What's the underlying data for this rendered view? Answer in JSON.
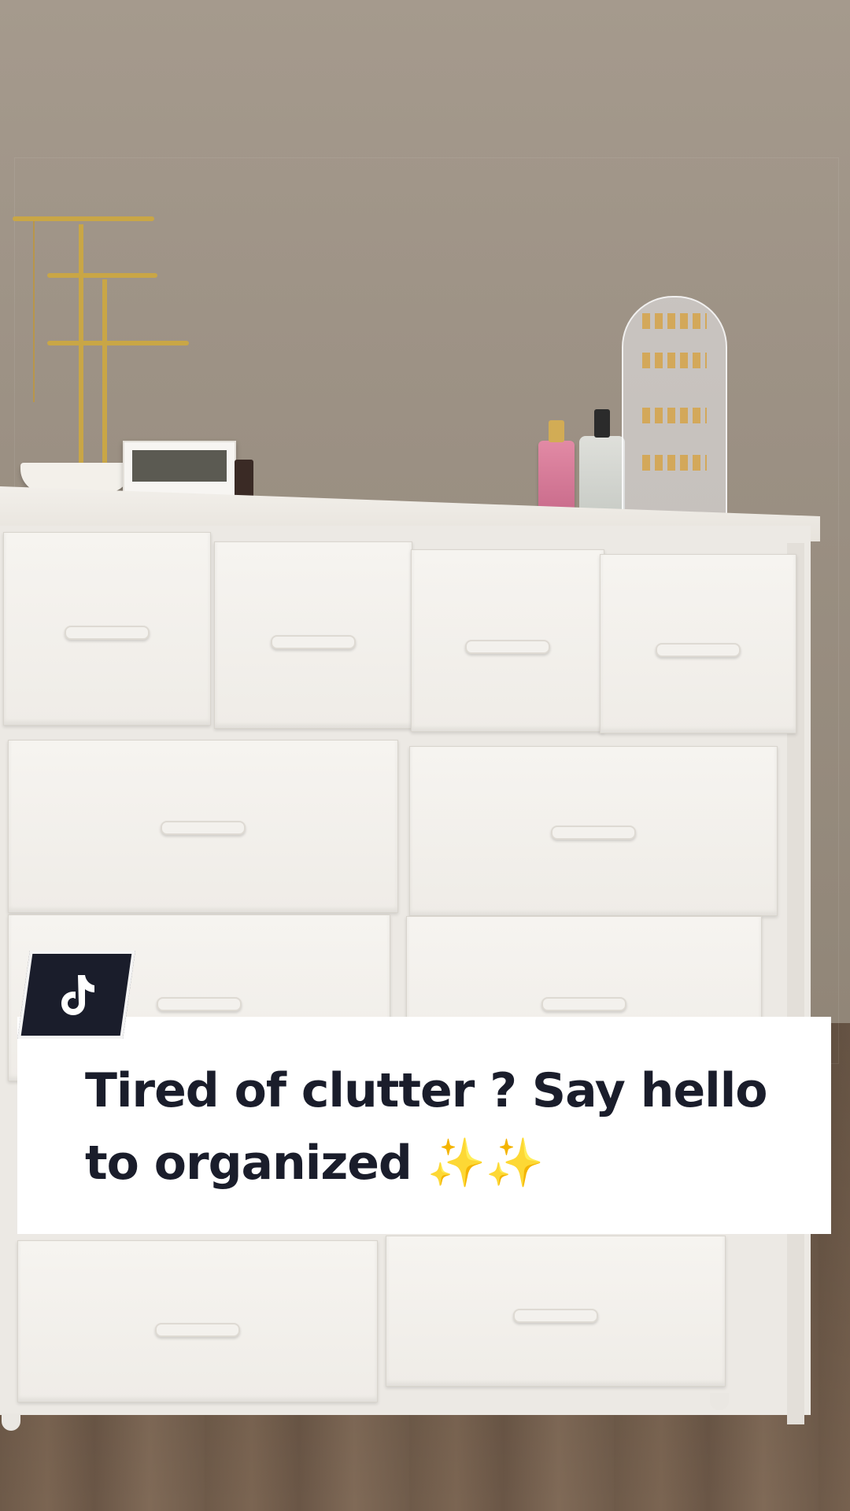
{
  "caption": {
    "text": "Tired of clutter ? Say hello to organized ✨✨"
  },
  "app": {
    "badge_icon": "tiktok-logo-icon"
  },
  "colors": {
    "caption_text": "#1a1d2b",
    "caption_bg": "#ffffff",
    "badge_bg": "#1a1d2b"
  }
}
